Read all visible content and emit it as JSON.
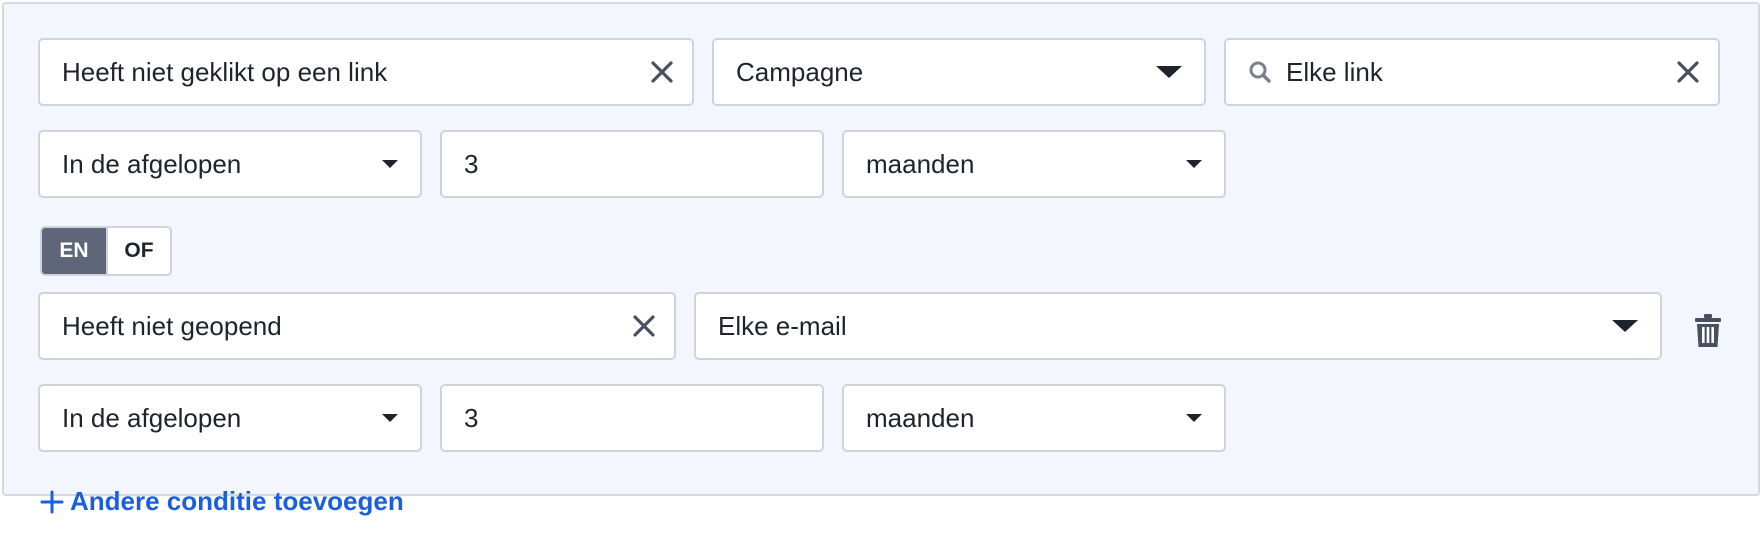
{
  "condition1": {
    "action": "Heeft niet geklikt op een link",
    "source": "Campagne",
    "link": "Elke link",
    "timeframe": "In de afgelopen",
    "amount": "3",
    "unit": "maanden"
  },
  "logic": {
    "and_label": "EN",
    "or_label": "OF",
    "active": "EN"
  },
  "condition2": {
    "action": "Heeft niet geopend",
    "email": "Elke e-mail",
    "timeframe": "In de afgelopen",
    "amount": "3",
    "unit": "maanden"
  },
  "add_condition_label": "Andere conditie toevoegen",
  "icons": {
    "clear": "close-icon",
    "search": "search-icon",
    "delete": "trash-icon",
    "add": "plus-icon",
    "dropdown": "caret-down-icon"
  },
  "colors": {
    "panel_bg": "#f3f6fc",
    "border": "#cfd3dc",
    "text": "#1e232c",
    "toggle_active": "#5f667a",
    "link": "#1a5fe0"
  }
}
